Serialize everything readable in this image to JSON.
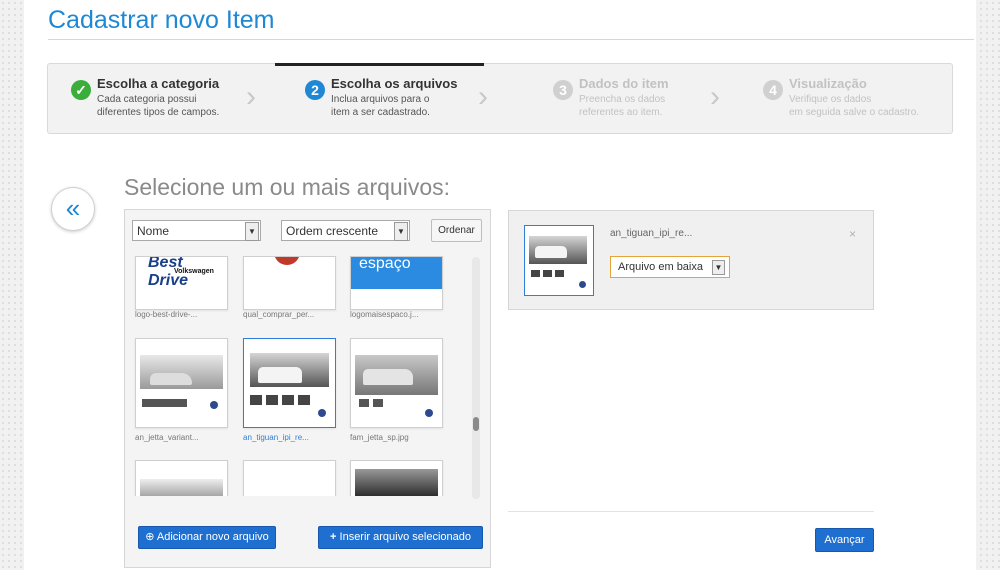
{
  "page": {
    "title": "Cadastrar novo Item"
  },
  "steps": [
    {
      "status": "done",
      "number": "✓",
      "title": "Escolha a categoria",
      "desc1": "Cada categoria possui",
      "desc2": "diferentes tipos de campos."
    },
    {
      "status": "active",
      "number": "2",
      "title": "Escolha os arquivos",
      "desc1": "Inclua arquivos para o",
      "desc2": "item a ser cadastrado."
    },
    {
      "status": "pending",
      "number": "3",
      "title": "Dados do item",
      "desc1": "Preencha os dados",
      "desc2": "referentes ao item."
    },
    {
      "status": "pending",
      "number": "4",
      "title": "Visualização",
      "desc1": "Verifique os dados",
      "desc2": "em seguida salve o cadastro."
    }
  ],
  "section_title": "Selecione um ou mais arquivos:",
  "browser": {
    "sort_field": "Nome",
    "sort_order": "Ordem crescente",
    "order_button": "Ordenar",
    "files": [
      {
        "name": "logo-best-drive-...",
        "thumb_text": "Best Drive",
        "thumb_sub": "Volkswagen",
        "selected": false
      },
      {
        "name": "qual_comprar_per...",
        "thumb_text": "",
        "thumb_sub": "",
        "selected": false
      },
      {
        "name": "logomaisespaco.j...",
        "thumb_text": "espaço",
        "thumb_sub": "",
        "selected": false
      },
      {
        "name": "an_jetta_variant...",
        "thumb_text": "",
        "thumb_sub": "",
        "selected": false
      },
      {
        "name": "an_tiguan_ipi_re...",
        "thumb_text": "",
        "thumb_sub": "",
        "selected": true
      },
      {
        "name": "fam_jetta_sp.jpg",
        "thumb_text": "",
        "thumb_sub": "",
        "selected": false
      }
    ],
    "add_button": "Adicionar novo arquivo",
    "insert_button": "Inserir arquivo selecionado",
    "add_icon": "plus-circle-icon",
    "insert_icon": "plus-icon"
  },
  "selected": {
    "name": "an_tiguan_ipi_re...",
    "mode": "Arquivo em baixa",
    "close": "×"
  },
  "next_button": "Avançar",
  "back_icon": "chevron-left-icon",
  "colors": {
    "accent": "#1e88d4",
    "button": "#1f6fd0",
    "success": "#3aad3a",
    "highlight": "#e5a43a"
  }
}
